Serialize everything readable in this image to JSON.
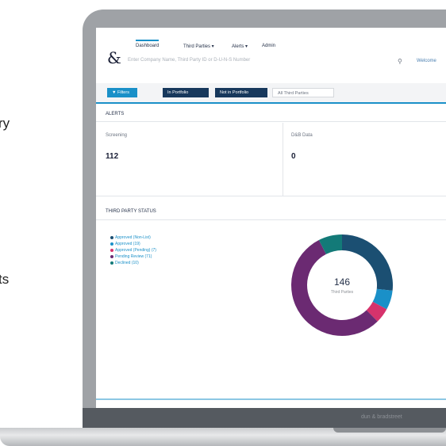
{
  "side_texts": [
    "ry",
    "ts"
  ],
  "laptop": {
    "brand": "dun & bradstreet"
  },
  "app": {
    "logo": "&",
    "tabs": [
      "Dashboard",
      "Third Parties ▾",
      "Alerts ▾",
      "Admin"
    ],
    "search_placeholder": "Enter Company Name, Third Party ID or D-U-N-S Number",
    "user": "Welcome",
    "filter_buttons": [
      "▼ Filters",
      "In Portfolio",
      "Not in Portfolio",
      "All Third Parties"
    ],
    "alerts": {
      "heading": "ALERTS",
      "cards": [
        {
          "label": "Screening",
          "value": "112"
        },
        {
          "label": "D&B Data",
          "value": "0"
        }
      ]
    },
    "third_party_status": {
      "heading": "THIRD PARTY STATUS",
      "legend": [
        {
          "label": "Approved (Non-List)",
          "color": "#1b4f72"
        },
        {
          "label": "Approved (19)",
          "color": "#1a90c8"
        },
        {
          "label": "Approved (Pending) (7)",
          "color": "#d6336c"
        },
        {
          "label": "Pending Review (71)",
          "color": "#6b2a72"
        },
        {
          "label": "Declined (10)",
          "color": "#137a78"
        }
      ],
      "center_count": "146",
      "center_label": "Third Parties"
    }
  },
  "chart_data": {
    "type": "pie",
    "categories": [
      "Approved (Non-List)",
      "Approved",
      "Approved (Pending)",
      "Pending Review",
      "Declined"
    ],
    "values": [
      39,
      9,
      7,
      80,
      11
    ],
    "colors": [
      "#1b4f72",
      "#1a90c8",
      "#d6336c",
      "#6b2a72",
      "#137a78"
    ]
  }
}
